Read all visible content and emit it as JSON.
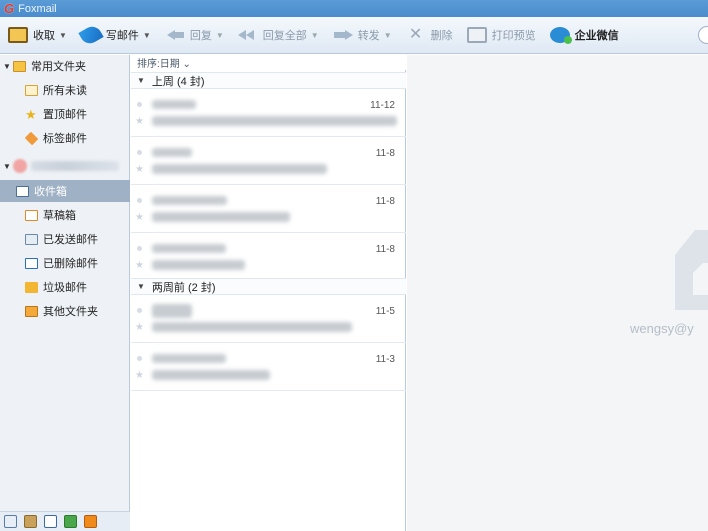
{
  "app": {
    "title": "Foxmail",
    "logo_glyph": "G"
  },
  "toolbar": {
    "receive": "收取",
    "compose": "写邮件",
    "reply": "回复",
    "reply_all": "回复全部",
    "forward": "转发",
    "delete": "删除",
    "print_preview": "打印预览",
    "wecom": "企业微信"
  },
  "sidebar": {
    "common_folders": "常用文件夹",
    "all_unread": "所有未读",
    "pinned_mail": "置顶邮件",
    "tagged_mail": "标签邮件",
    "inbox": "收件箱",
    "drafts": "草稿箱",
    "sent": "已发送邮件",
    "deleted": "已删除邮件",
    "junk": "垃圾邮件",
    "other_folders": "其他文件夹"
  },
  "mail_list": {
    "sort_label": "排序:日期 ⌄",
    "groups": [
      {
        "label": "上周 (4 封)"
      },
      {
        "label": "两周前 (2 封)"
      }
    ],
    "items": [
      {
        "date": "11-12"
      },
      {
        "date": "11-8"
      },
      {
        "date": "11-8"
      },
      {
        "date": "11-8"
      },
      {
        "date": "11-5"
      },
      {
        "date": "11-3"
      }
    ]
  },
  "reading_pane": {
    "account_text": "wengsy@y"
  },
  "colors": {
    "title_bar": "#4a8ccd",
    "selected_folder": "#9fb1c5",
    "accent_red": "#e23a2a"
  }
}
